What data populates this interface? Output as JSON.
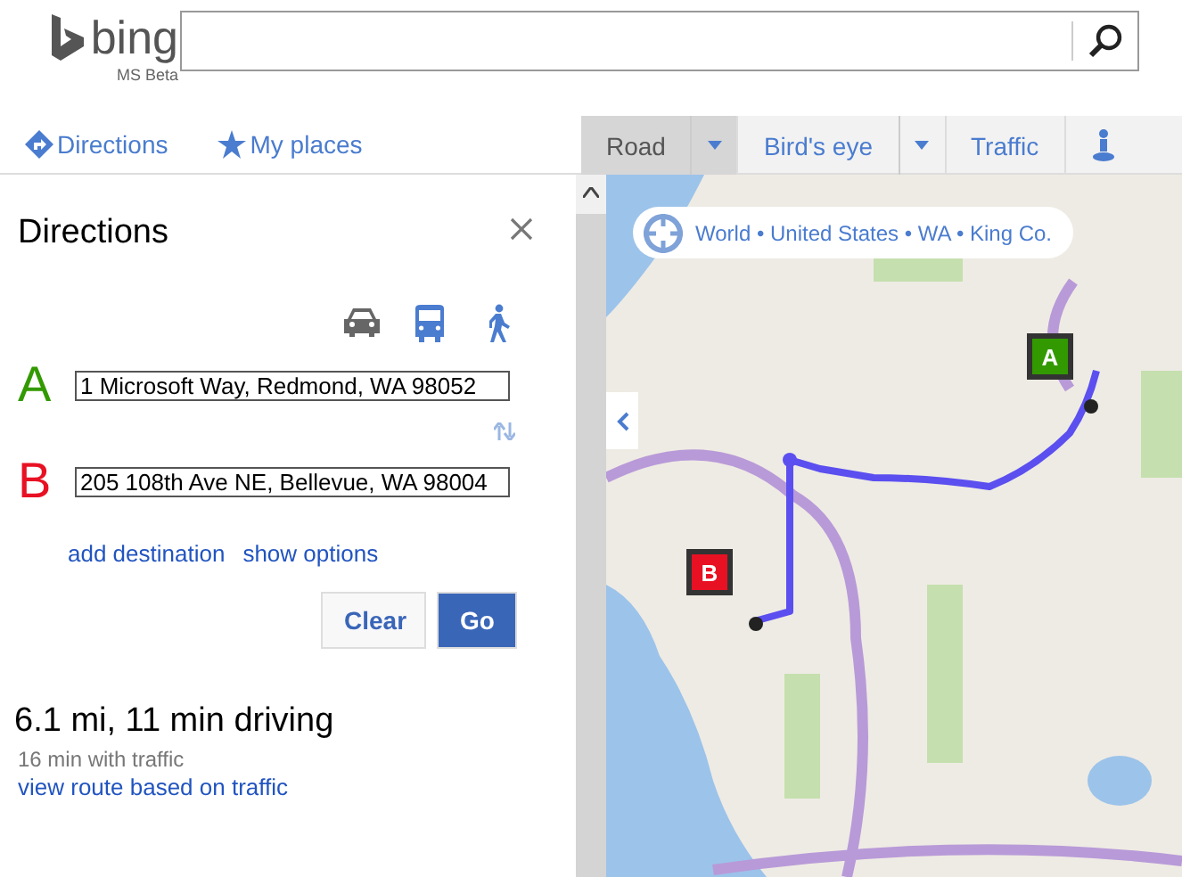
{
  "header": {
    "logo": "bing",
    "logo_sub": "MS Beta"
  },
  "nav": [
    {
      "label": "Directions",
      "kind": "directions"
    },
    {
      "label": "My places",
      "kind": "star"
    }
  ],
  "map_tabs": [
    {
      "label": "Road",
      "selected": true,
      "dropdown": true
    },
    {
      "label": "Bird's eye",
      "selected": false,
      "dropdown": true
    },
    {
      "label": "Traffic",
      "selected": false,
      "dropdown": false
    }
  ],
  "panel": {
    "title": "Directions",
    "modes": [
      {
        "kind": "car",
        "selected": true
      },
      {
        "kind": "bus",
        "selected": false
      },
      {
        "kind": "walk",
        "selected": false
      }
    ],
    "waypoints": [
      {
        "letter": "A",
        "color": "#339900",
        "value": "1 Microsoft Way, Redmond, WA 98052"
      },
      {
        "letter": "B",
        "color": "#e81123",
        "value": "205 108th Ave NE, Bellevue, WA 98004"
      }
    ],
    "links": [
      "add destination",
      "show options"
    ],
    "buttons": [
      {
        "label": "Clear",
        "kind": "secondary"
      },
      {
        "label": "Go",
        "kind": "primary"
      }
    ],
    "summary": "6.1 mi, 11 min driving",
    "traffic_note": "16 min with traffic",
    "traffic_link": "view route based on traffic"
  },
  "map": {
    "kind": "picture",
    "breadcrumb": "World • United States • WA • King Co.",
    "markers": [
      {
        "label": "A",
        "color": "#339900"
      },
      {
        "label": "B",
        "color": "#e81123"
      }
    ]
  }
}
